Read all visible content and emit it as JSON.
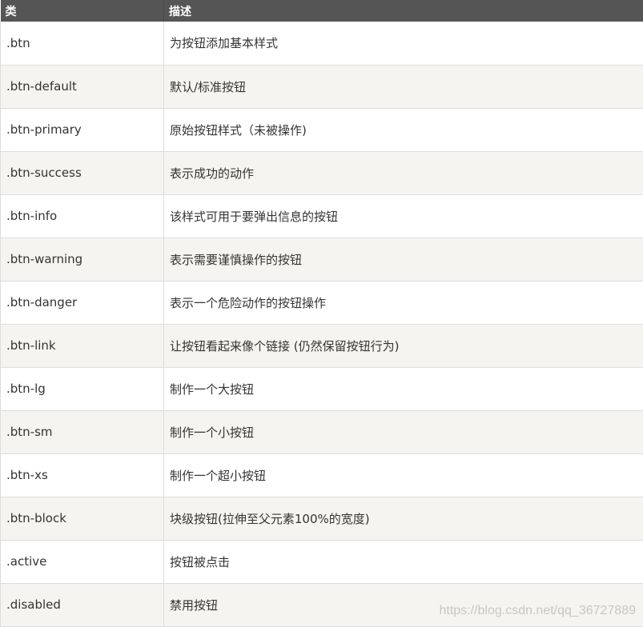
{
  "table": {
    "headers": [
      "类",
      "描述"
    ],
    "rows": [
      {
        "cls": ".btn",
        "desc": "为按钮添加基本样式"
      },
      {
        "cls": ".btn-default",
        "desc": "默认/标准按钮"
      },
      {
        "cls": ".btn-primary",
        "desc": "原始按钮样式（未被操作)"
      },
      {
        "cls": ".btn-success",
        "desc": "表示成功的动作"
      },
      {
        "cls": ".btn-info",
        "desc": "该样式可用于要弹出信息的按钮"
      },
      {
        "cls": ".btn-warning",
        "desc": "表示需要谨慎操作的按钮"
      },
      {
        "cls": ".btn-danger",
        "desc": "表示一个危险动作的按钮操作"
      },
      {
        "cls": ".btn-link",
        "desc": "让按钮看起来像个链接 (仍然保留按钮行为)"
      },
      {
        "cls": ".btn-lg",
        "desc": "制作一个大按钮"
      },
      {
        "cls": ".btn-sm",
        "desc": "制作一个小按钮"
      },
      {
        "cls": ".btn-xs",
        "desc": "制作一个超小按钮"
      },
      {
        "cls": ".btn-block",
        "desc": "块级按钮(拉伸至父元素100%的宽度)"
      },
      {
        "cls": ".active",
        "desc": "按钮被点击"
      },
      {
        "cls": ".disabled",
        "desc": "禁用按钮"
      }
    ]
  },
  "watermark": "https://blog.csdn.net/qq_36727889",
  "colors": {
    "header_bg": "#555555",
    "header_text": "#ffffff",
    "row_alt_bg": "#f5f4f0",
    "border": "#dddddd"
  }
}
